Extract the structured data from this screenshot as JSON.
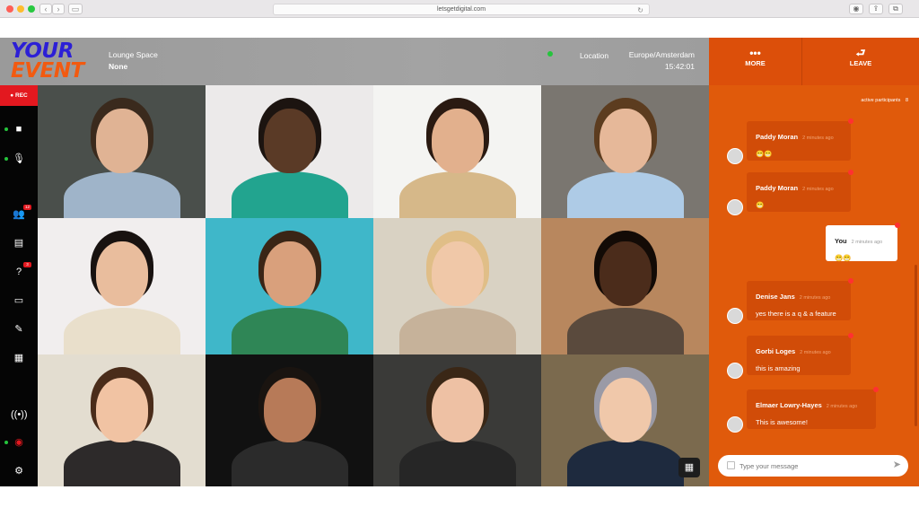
{
  "browser": {
    "url": "letsgetdigital.com"
  },
  "logo": {
    "line1": "YOUR",
    "line2": "EVENT"
  },
  "header": {
    "space_label": "Lounge Space",
    "space_value": "None",
    "location_label": "Location",
    "timezone": "Europe/Amsterdam",
    "time": "15:42:01"
  },
  "actions": {
    "more": "MORE",
    "leave": "LEAVE"
  },
  "sidebar": {
    "rec": "● REC",
    "participants_badge": "12",
    "questions_badge": "3"
  },
  "participants": [
    {
      "bg": "#4a4f4b",
      "skin": "#e0b394",
      "hair": "#3a2a1d",
      "shirt": "#9fb4c9"
    },
    {
      "bg": "#eceaea",
      "skin": "#5a3a26",
      "hair": "#1c1410",
      "shirt": "#22a48f"
    },
    {
      "bg": "#f4f4f2",
      "skin": "#e2b08d",
      "hair": "#2a1a12",
      "shirt": "#d6b889"
    },
    {
      "bg": "#7a7670",
      "skin": "#e6b899",
      "hair": "#5c3c1f",
      "shirt": "#aecbe6"
    },
    {
      "bg": "#f1eeee",
      "skin": "#e9bd9d",
      "hair": "#181210",
      "shirt": "#e9dfcb"
    },
    {
      "bg": "#3fb7c9",
      "skin": "#d9a07c",
      "hair": "#3a2516",
      "shirt": "#2f8656"
    },
    {
      "bg": "#d9d2c3",
      "skin": "#f0c8a8",
      "hair": "#e0be87",
      "shirt": "#c6b29a"
    },
    {
      "bg": "#b8875e",
      "skin": "#4b2c1b",
      "hair": "#130b06",
      "shirt": "#5a4a3d"
    },
    {
      "bg": "#e3ddd0",
      "skin": "#f1c3a3",
      "hair": "#4a2c1a",
      "shirt": "#2d2a2a"
    },
    {
      "bg": "#111111",
      "skin": "#b77a58",
      "hair": "#1a1410",
      "shirt": "#2b2b2b"
    },
    {
      "bg": "#3a3a38",
      "skin": "#eec1a4",
      "hair": "#3a2716",
      "shirt": "#262626"
    },
    {
      "bg": "#7b6a4e",
      "skin": "#f0c8aa",
      "hair": "#9a9aa6",
      "shirt": "#1e2a3e"
    }
  ],
  "chat": {
    "active_label": "active participants",
    "active_count": "8",
    "messages": [
      {
        "name": "Paddy Moran",
        "time": "2 minutes ago",
        "text": "😁😁",
        "me": false
      },
      {
        "name": "Paddy Moran",
        "time": "2 minutes ago",
        "text": "😁",
        "me": false
      },
      {
        "name": "You",
        "time": "2 minutes ago",
        "text": "😁😁",
        "me": true
      },
      {
        "name": "Denise Jans",
        "time": "2 minutes ago",
        "text": "yes there is a q & a feature",
        "me": false
      },
      {
        "name": "Gorbi Loges",
        "time": "2 minutes ago",
        "text": "this is amazing",
        "me": false
      },
      {
        "name": "Elmaer Lowry-Hayes",
        "time": "2 minutes ago",
        "text": "This is awesome!",
        "me": false
      }
    ],
    "composer_placeholder": "Type your message"
  }
}
